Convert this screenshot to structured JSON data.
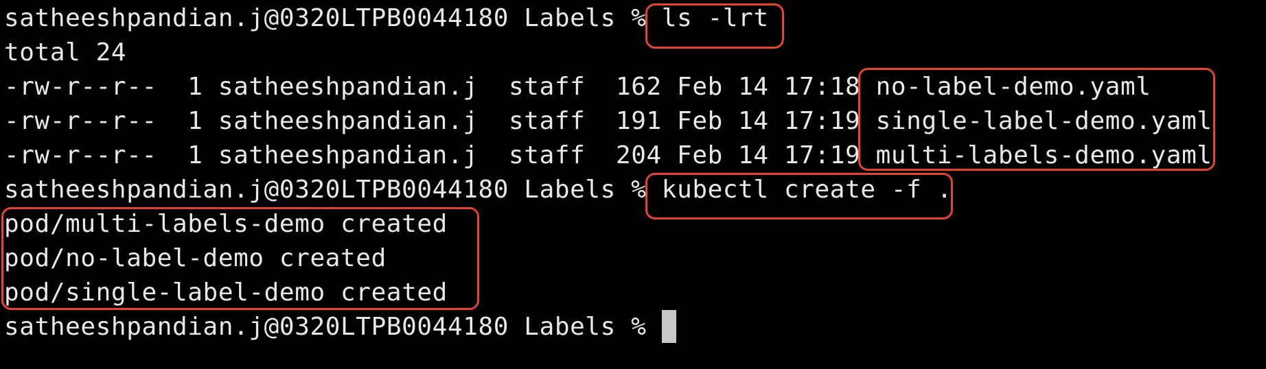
{
  "prompt": "satheeshpandian.j@0320LTPB0044180 Labels %",
  "lines": [
    {
      "prompt": "satheeshpandian.j@0320LTPB0044180 Labels %",
      "command": "ls -lrt"
    },
    {
      "output": "total 24"
    },
    {
      "meta": "-rw-r--r--  1 satheeshpandian.j  staff  162 Feb 14 17:18",
      "file": "no-label-demo.yaml"
    },
    {
      "meta": "-rw-r--r--  1 satheeshpandian.j  staff  191 Feb 14 17:19",
      "file": "single-label-demo.yaml"
    },
    {
      "meta": "-rw-r--r--  1 satheeshpandian.j  staff  204 Feb 14 17:19",
      "file": "multi-labels-demo.yaml"
    },
    {
      "prompt": "satheeshpandian.j@0320LTPB0044180 Labels %",
      "command": "kubectl create -f ."
    },
    {
      "output": "pod/multi-labels-demo created"
    },
    {
      "output": "pod/no-label-demo created"
    },
    {
      "output": "pod/single-label-demo created"
    },
    {
      "prompt": "satheeshpandian.j@0320LTPB0044180 Labels %",
      "command": ""
    }
  ],
  "colors": {
    "background": "#000000",
    "text": "#e8e8e8",
    "highlight": "#e8432e",
    "cursor": "#c8c8c8"
  }
}
